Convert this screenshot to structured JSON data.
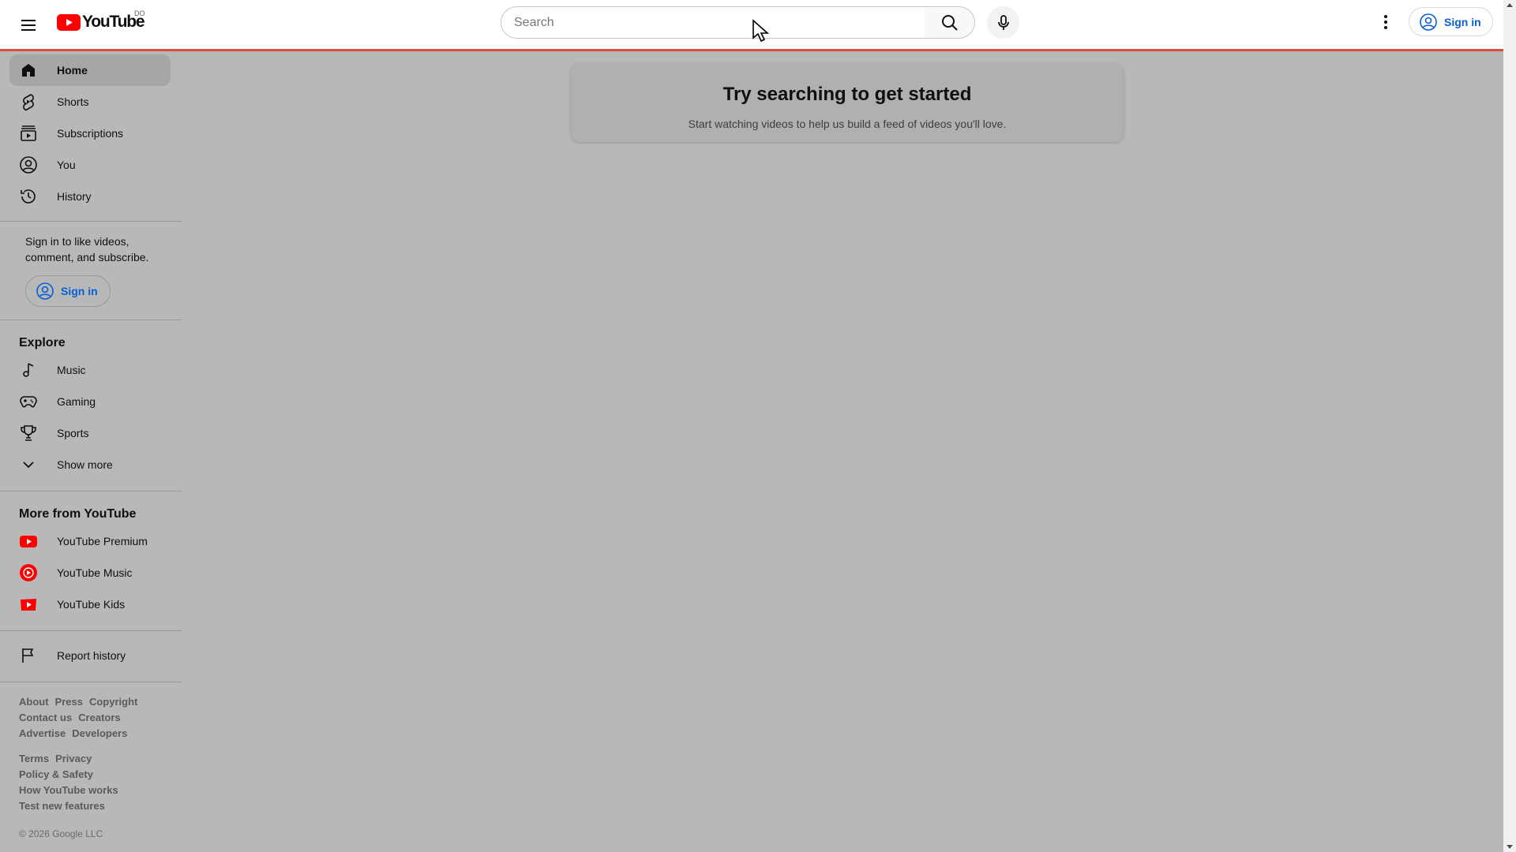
{
  "header": {
    "logo_text": "YouTube",
    "logo_country": "DO",
    "search_placeholder": "Search",
    "sign_in_label": "Sign in"
  },
  "sidebar": {
    "main_items": [
      {
        "label": "Home",
        "icon": "home-icon",
        "active": true
      },
      {
        "label": "Shorts",
        "icon": "shorts-icon"
      },
      {
        "label": "Subscriptions",
        "icon": "subscriptions-icon"
      },
      {
        "label": "You",
        "icon": "you-icon"
      },
      {
        "label": "History",
        "icon": "history-icon"
      }
    ],
    "signin_prompt": "Sign in to like videos, comment, and subscribe.",
    "signin_button": "Sign in",
    "explore_title": "Explore",
    "explore_items": [
      {
        "label": "Music",
        "icon": "music-note-icon"
      },
      {
        "label": "Gaming",
        "icon": "gaming-icon"
      },
      {
        "label": "Sports",
        "icon": "trophy-icon"
      },
      {
        "label": "Show more",
        "icon": "chevron-down-icon"
      }
    ],
    "more_title": "More from YouTube",
    "more_items": [
      {
        "label": "YouTube Premium",
        "icon": "youtube-premium-icon"
      },
      {
        "label": "YouTube Music",
        "icon": "youtube-music-icon"
      },
      {
        "label": "YouTube Kids",
        "icon": "youtube-kids-icon"
      }
    ],
    "report_history": "Report history",
    "footer_links_1": [
      [
        "About",
        "Press",
        "Copyright"
      ],
      [
        "Contact us",
        "Creators"
      ],
      [
        "Advertise",
        "Developers"
      ]
    ],
    "footer_links_2": [
      [
        "Terms",
        "Privacy"
      ],
      [
        "Policy & Safety"
      ],
      [
        "How YouTube works"
      ],
      [
        "Test new features"
      ]
    ],
    "copyright": "© 2026 Google LLC"
  },
  "main": {
    "card_title": "Try searching to get started",
    "card_subtitle": "Start watching videos to help us build a feed of videos you'll love."
  },
  "colors": {
    "brand_red": "#ff0000",
    "link_blue": "#065fd4",
    "header_border": "#e04b3c",
    "overlay_gray": "#b8b8b8"
  }
}
